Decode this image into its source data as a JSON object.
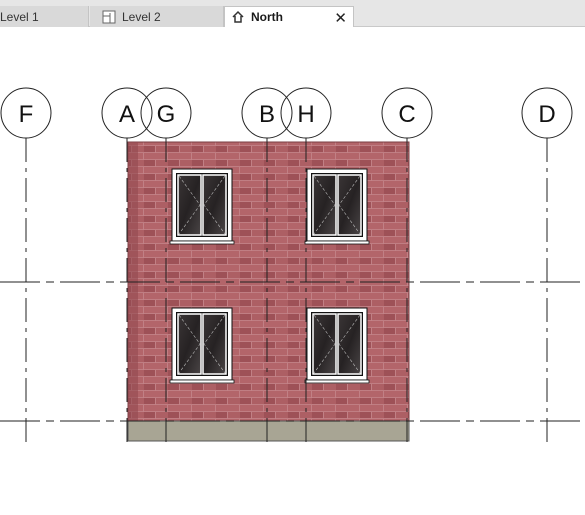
{
  "tabs": [
    {
      "label": "Level 1",
      "icon": "floor-plan-icon",
      "active": false
    },
    {
      "label": "Level 2",
      "icon": "floor-plan-icon",
      "active": false
    },
    {
      "label": "North",
      "icon": "elevation-house-icon",
      "active": true
    }
  ],
  "close_glyph": "✕",
  "view": {
    "name": "North",
    "grids": [
      {
        "label": "F"
      },
      {
        "label": "A"
      },
      {
        "label": "G"
      },
      {
        "label": "B"
      },
      {
        "label": "H"
      },
      {
        "label": "C"
      },
      {
        "label": "D"
      }
    ],
    "colors": {
      "brick": "#a85a60",
      "mortar": "#c88a8e",
      "foundation": "#a8a594",
      "window_frame": "#ffffff",
      "glass": "#2e2a2b",
      "tab_active": "#ffffff",
      "tab_inactive": "#d9d9d9"
    }
  }
}
